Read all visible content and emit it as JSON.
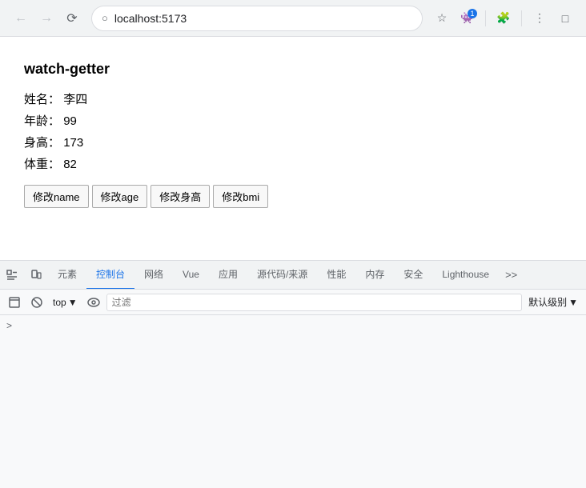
{
  "browser": {
    "url": "localhost:5173",
    "back_disabled": true,
    "forward_disabled": true,
    "star_icon": "☆",
    "profile_icon": "👾",
    "badge_count": "1"
  },
  "page": {
    "title": "watch-getter",
    "fields": [
      {
        "label": "姓名：",
        "value": "李四"
      },
      {
        "label": "年龄：",
        "value": "99"
      },
      {
        "label": "身高：",
        "value": "173"
      },
      {
        "label": "体重：",
        "value": "82"
      }
    ],
    "buttons": [
      {
        "label": "修改name"
      },
      {
        "label": "修改age"
      },
      {
        "label": "修改身高"
      },
      {
        "label": "修改bmi"
      }
    ]
  },
  "devtools": {
    "tabs": [
      {
        "label": "元素",
        "active": false
      },
      {
        "label": "控制台",
        "active": true
      },
      {
        "label": "网络",
        "active": false
      },
      {
        "label": "Vue",
        "active": false
      },
      {
        "label": "应用",
        "active": false
      },
      {
        "label": "源代码/来源",
        "active": false
      },
      {
        "label": "性能",
        "active": false
      },
      {
        "label": "内存",
        "active": false
      },
      {
        "label": "安全",
        "active": false
      },
      {
        "label": "Lighthouse",
        "active": false
      }
    ],
    "more_label": ">>",
    "toolbar": {
      "top_label": "top",
      "filter_placeholder": "过滤",
      "log_level_label": "默认级别",
      "chevron": "▼"
    },
    "console_arrow": ">"
  }
}
